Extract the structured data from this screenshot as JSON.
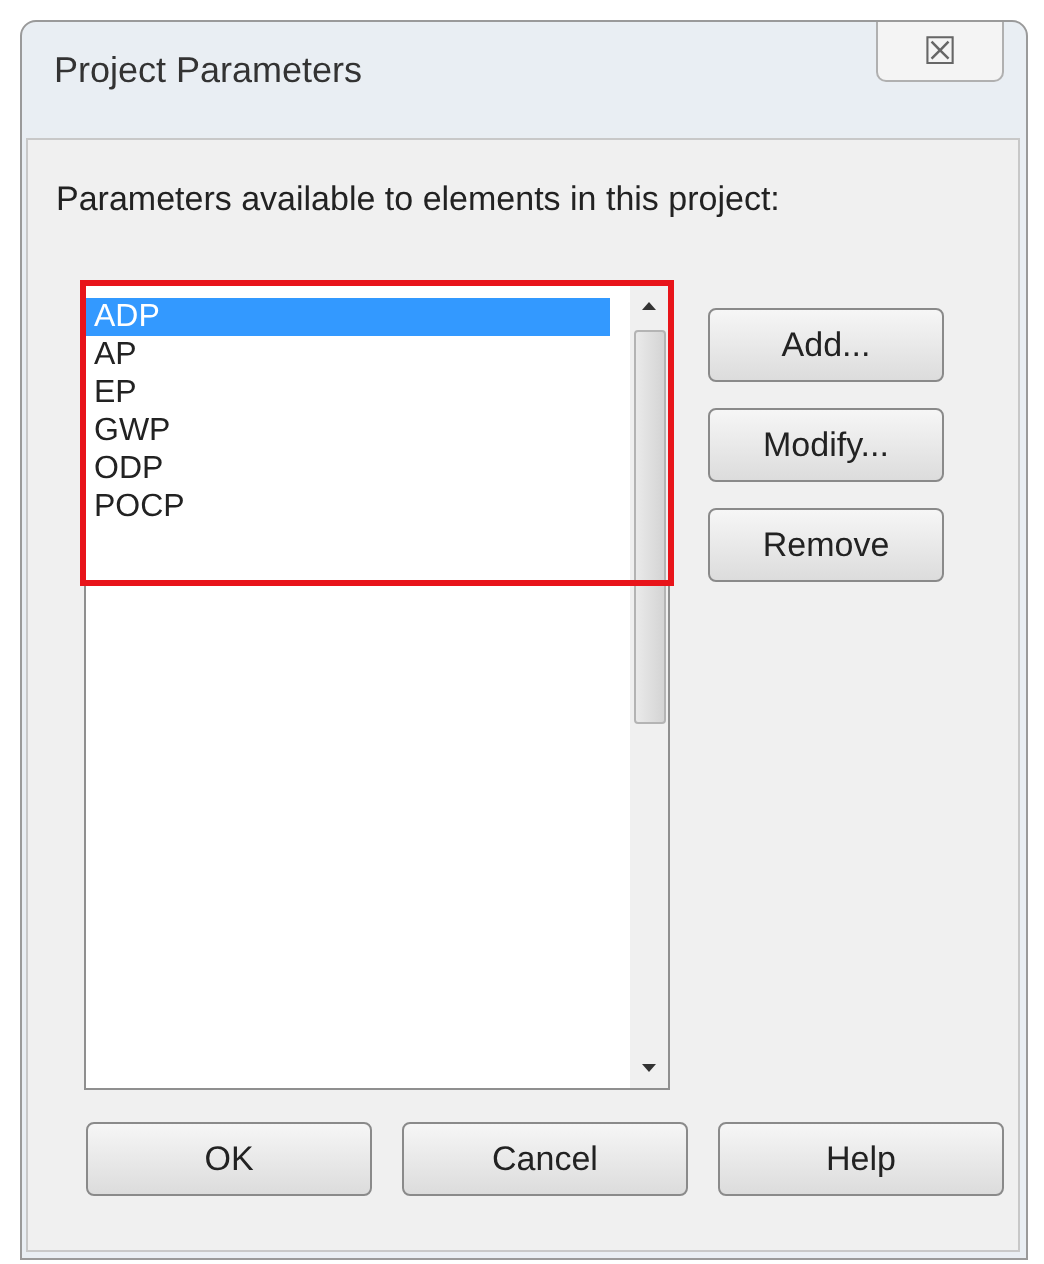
{
  "window": {
    "title": "Project Parameters",
    "close_icon": "☒"
  },
  "label": "Parameters available to elements in this project:",
  "list": {
    "highlighted": true,
    "items": [
      {
        "label": "ADP",
        "selected": true
      },
      {
        "label": "AP",
        "selected": false
      },
      {
        "label": "EP",
        "selected": false
      },
      {
        "label": "GWP",
        "selected": false
      },
      {
        "label": "ODP",
        "selected": false
      },
      {
        "label": "POCP",
        "selected": false
      }
    ]
  },
  "side_buttons": [
    "Add...",
    "Modify...",
    "Remove"
  ],
  "bottom_buttons": [
    "OK",
    "Cancel",
    "Help"
  ]
}
